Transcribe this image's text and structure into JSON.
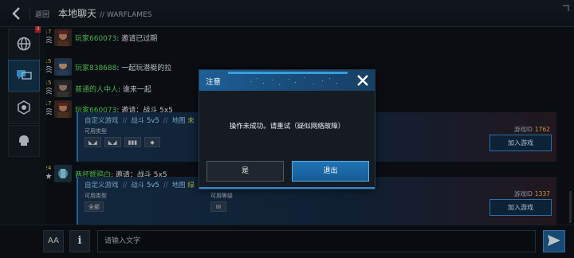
{
  "header": {
    "back_label": "返回",
    "title": "本地聊天",
    "subtitle": "// WARFLAMES"
  },
  "sidebar": {
    "notification_count": "3",
    "items": [
      {
        "name": "globe",
        "active": false
      },
      {
        "name": "chat",
        "active": true
      },
      {
        "name": "clan",
        "active": false
      },
      {
        "name": "squad",
        "active": false
      }
    ]
  },
  "messages": [
    {
      "level": "17",
      "name": "玩家660073",
      "text": "邀请已过期"
    },
    {
      "level": "15",
      "name": "玩家838688",
      "text": "一起玩潜艇的拉"
    },
    {
      "level": "15",
      "name": "普通的人中人",
      "text": "谁来一起"
    },
    {
      "level": "17",
      "name": "玩家660073",
      "text": "邀请：战斗 5x5"
    },
    {
      "level": "24",
      "name": "两杯颤鸦白",
      "text": "邀请：战斗 5x5"
    }
  ],
  "cards": [
    {
      "mode": "自定义游戏",
      "battle_label": "战斗",
      "battle_value": "5v5",
      "map_label": "地图",
      "map_value": "未",
      "sub_label": "可用类型",
      "tags": [
        "◣◢",
        "◣◢",
        "▮▮▮",
        "◆"
      ],
      "id_label": "游戏ID",
      "id_value": "1762",
      "join_label": "加入游戏"
    },
    {
      "mode": "自定义游戏",
      "battle_label": "战斗",
      "battle_value": "5v5",
      "map_label": "地图",
      "map_value": "绿",
      "sub_label": "可用类型",
      "sub_label2": "可用等级",
      "tags": [
        "全部"
      ],
      "tags2": [
        "III"
      ],
      "id_label": "游戏ID",
      "id_value": "1337",
      "join_label": "加入游戏"
    }
  ],
  "input": {
    "placeholder": "请输入文字",
    "font_btn": "AA",
    "info_btn": "i"
  },
  "dialog": {
    "title": "注意",
    "message": "操作未成功。请重试（疑似网络故障）",
    "yes_label": "是",
    "exit_label": "退出"
  },
  "colors": {
    "accent": "#1f73b5",
    "player_name": "#5fd65f",
    "level": "#e7c34a"
  }
}
